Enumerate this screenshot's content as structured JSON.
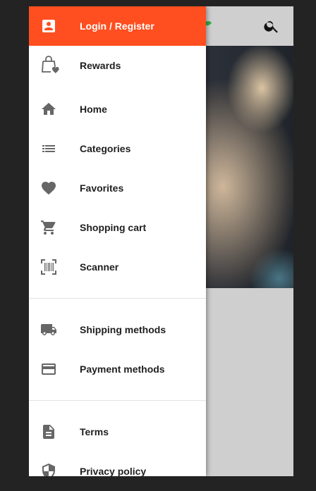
{
  "drawer": {
    "header": {
      "label": "Login / Register",
      "icon": "account-box-icon"
    },
    "items": [
      {
        "label": "Rewards",
        "icon": "shopping-bag-heart-icon"
      },
      {
        "label": "Home",
        "icon": "home-icon"
      },
      {
        "label": "Categories",
        "icon": "list-icon"
      },
      {
        "label": "Favorites",
        "icon": "heart-icon"
      },
      {
        "label": "Shopping cart",
        "icon": "cart-icon"
      },
      {
        "label": "Scanner",
        "icon": "barcode-scan-icon"
      },
      {
        "label": "Shipping methods",
        "icon": "truck-icon"
      },
      {
        "label": "Payment methods",
        "icon": "credit-card-icon"
      },
      {
        "label": "Terms",
        "icon": "document-icon"
      },
      {
        "label": "Privacy policy",
        "icon": "shield-icon"
      }
    ]
  },
  "appbar": {
    "search_icon": "search-icon"
  },
  "colors": {
    "accent": "#ff4e1f",
    "drawer_background": "#ffffff",
    "icon": "#666666",
    "text": "#1f1f1f",
    "scrim": "#232323"
  }
}
